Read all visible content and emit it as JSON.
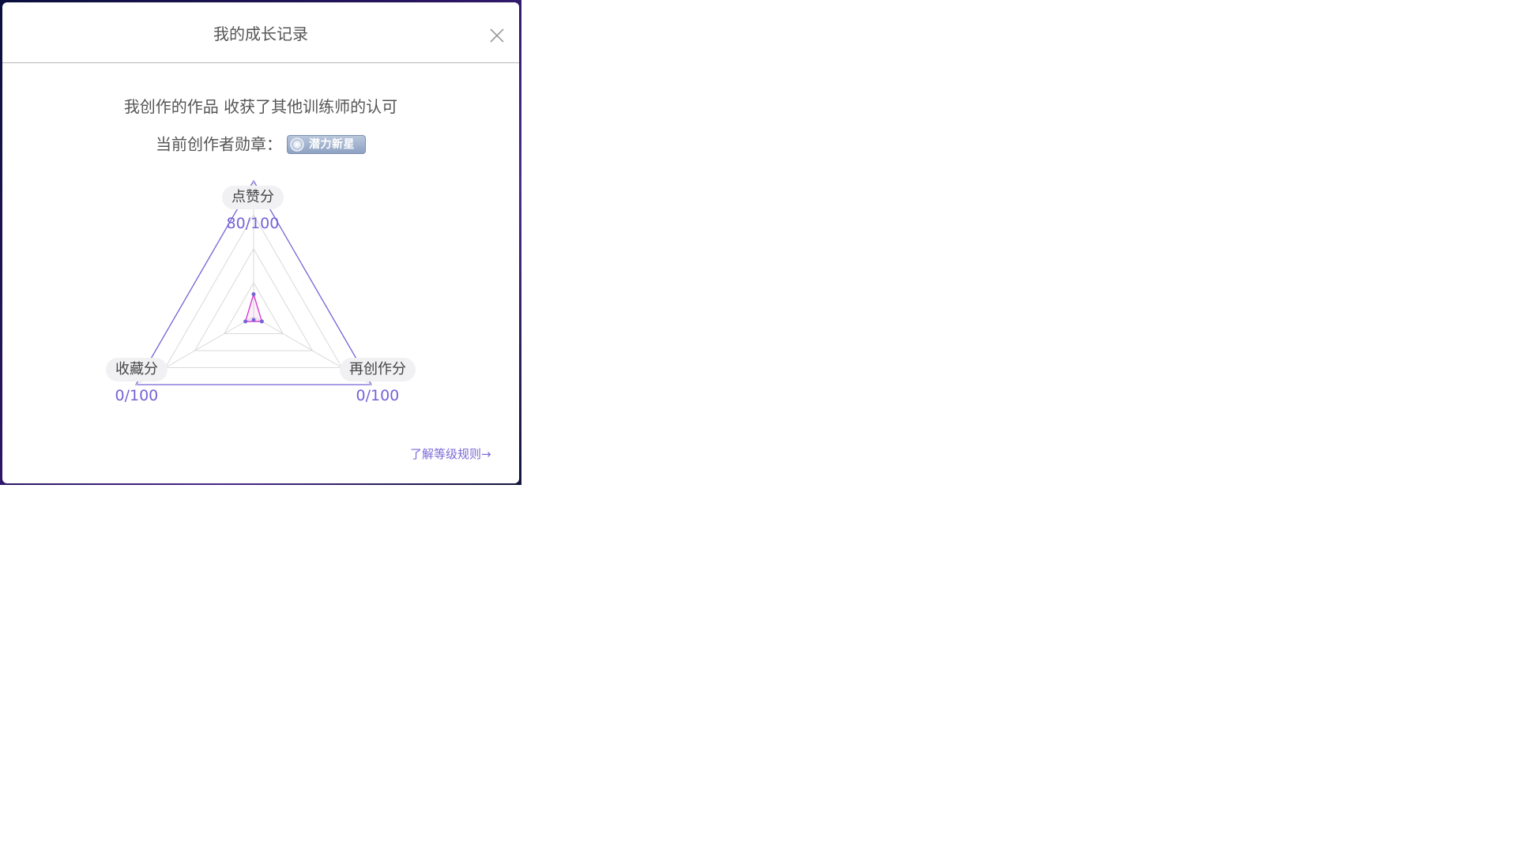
{
  "dialog": {
    "title": "我的成长记录",
    "subtitle": "我创作的作品 收获了其他训练师的认可",
    "badge_label": "当前创作者勋章：",
    "badge_name": "潜力新星",
    "rules_link": "了解等级规则→"
  },
  "colors": {
    "accent": "#7563d6",
    "grid": "#d9d9d9",
    "data_stroke": "#d63ecf"
  },
  "chart_data": {
    "type": "radar",
    "max": 100,
    "axes": [
      {
        "label": "点赞分",
        "value": 80,
        "max": 100,
        "display": "80/100"
      },
      {
        "label": "再创作分",
        "value": 0,
        "max": 100,
        "display": "0/100"
      },
      {
        "label": "收藏分",
        "value": 0,
        "max": 100,
        "display": "0/100"
      }
    ]
  }
}
